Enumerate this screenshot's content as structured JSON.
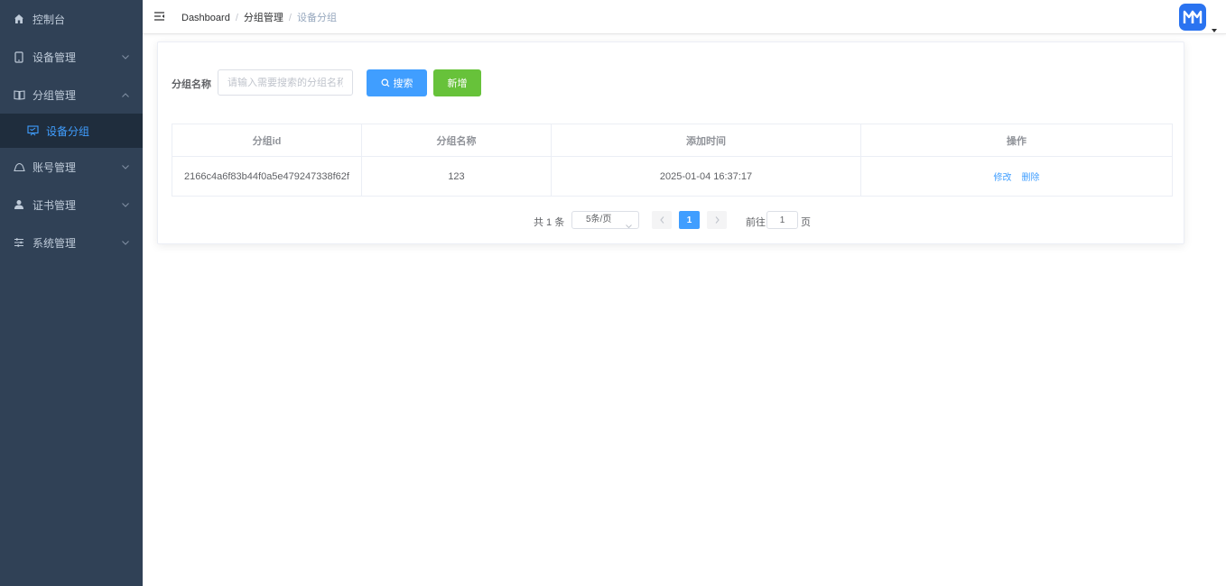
{
  "sidebar": {
    "items": [
      {
        "label": "控制台",
        "icon": "home-icon",
        "expandable": false
      },
      {
        "label": "设备管理",
        "icon": "tablet-icon",
        "expandable": true,
        "expanded": false
      },
      {
        "label": "分组管理",
        "icon": "book-icon",
        "expandable": true,
        "expanded": true,
        "children": [
          {
            "label": "设备分组",
            "icon": "monitor-icon",
            "active": true
          }
        ]
      },
      {
        "label": "账号管理",
        "icon": "cloud-icon",
        "expandable": true,
        "expanded": false
      },
      {
        "label": "证书管理",
        "icon": "user-icon",
        "expandable": true,
        "expanded": false
      },
      {
        "label": "系统管理",
        "icon": "sliders-icon",
        "expandable": true,
        "expanded": false
      }
    ],
    "bg_color": "#304156",
    "active_color": "#409eff"
  },
  "header": {
    "breadcrumb": [
      "Dashboard",
      "分组管理",
      "设备分组"
    ],
    "avatar_icon": "logo-icon"
  },
  "filter": {
    "label": "分组名称",
    "placeholder": "请输入需要搜索的分组名称",
    "value": "",
    "search_label": "搜索",
    "add_label": "新增"
  },
  "table": {
    "headers": [
      "分组id",
      "分组名称",
      "添加时间",
      "操作"
    ],
    "rows": [
      {
        "id": "2166c4a6f83b44f0a5e479247338f62f",
        "name": "123",
        "added": "2025-01-04 16:37:17",
        "actions": [
          "修改",
          "删除"
        ]
      }
    ]
  },
  "pagination": {
    "total_text": "共 1 条",
    "page_size": "5条/页",
    "current_page": "1",
    "goto_label": "前往",
    "goto_value": "1",
    "goto_suffix": "页"
  },
  "colors": {
    "primary": "#409eff",
    "success": "#67c23a",
    "sidebar": "#304156",
    "sidebar_sub": "#1f2d3d"
  }
}
